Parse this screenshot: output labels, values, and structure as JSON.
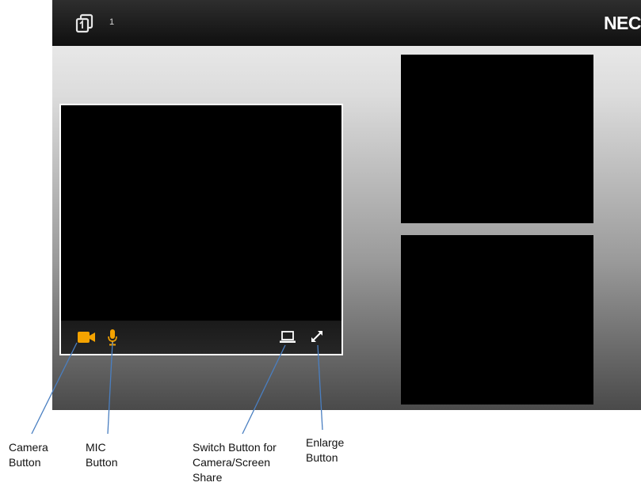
{
  "topbar": {
    "participant_icon": "participants-icon",
    "participant_count": "1",
    "logo": "NEC"
  },
  "main_video": {
    "controls": {
      "camera_icon": "video-camera-icon",
      "mic_icon": "microphone-icon",
      "switch_icon": "laptop-screen-share-icon",
      "enlarge_icon": "expand-arrows-icon"
    }
  },
  "annotations": {
    "camera": [
      "Camera",
      "Button"
    ],
    "mic": [
      "MIC",
      "Button"
    ],
    "switch": [
      "Switch Button for",
      "Camera/Screen",
      "Share"
    ],
    "enlarge": [
      "Enlarge",
      "Button"
    ]
  },
  "colors": {
    "accent": "#f5a300",
    "annotation_line": "#4a7fc1"
  }
}
